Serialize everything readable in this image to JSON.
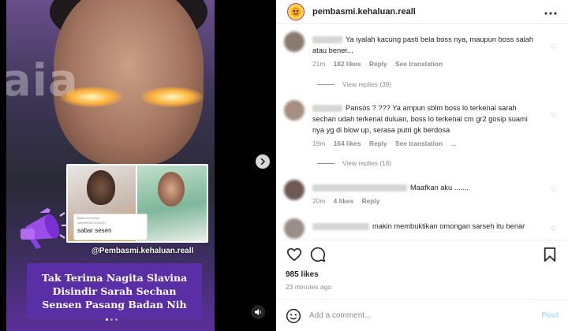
{
  "media": {
    "watermark_text": "aia",
    "comment_card": {
      "label": "Balas komentar",
      "user": "user9956274054287",
      "text": "sabar sesen"
    },
    "handle": "@Pembasmi.kehaluan.reall",
    "headline_lines": [
      "Tak Terima Nagita Slavina",
      "Disindir Sarah Sechan",
      "Sensen Pasang Badan Nih"
    ]
  },
  "post_header": {
    "username": "pembasmi.kehaluan.reall",
    "more_icon": "more-horizontal-icon"
  },
  "comments": [
    {
      "text": "Ya iyalah kacung pasti bela boss nya, maupun boss salah atau bener...",
      "time": "21m",
      "likes": "182 likes",
      "reply": "Reply",
      "translate": "See translation",
      "view_replies": "View replies (39)"
    },
    {
      "text": "Pansos ? ??? Ya ampun sblm boss lo terkenal sarah sechan udah terkenal duluan, boss lo terkenal cm gr2 gosip suami nya yg di blow up, serasa putri gk berdosa",
      "time": "19m",
      "likes": "164 likes",
      "reply": "Reply",
      "translate": "See translation",
      "more": "...",
      "view_replies": "View replies (18)"
    },
    {
      "text": "Maafkan aku .......",
      "time": "20m",
      "likes": "4 likes",
      "reply": "Reply"
    },
    {
      "text": "makin membuktikan omongan sarseh itu benar"
    }
  ],
  "stats": {
    "likes": "985 likes",
    "time_ago": "23 minutes ago"
  },
  "add_comment": {
    "placeholder": "Add a comment...",
    "post_label": "Post"
  },
  "colors": {
    "headline_bg": "#5a2fa6",
    "post_disabled": "#b3dbff",
    "secondary_text": "#8e8e8e"
  }
}
